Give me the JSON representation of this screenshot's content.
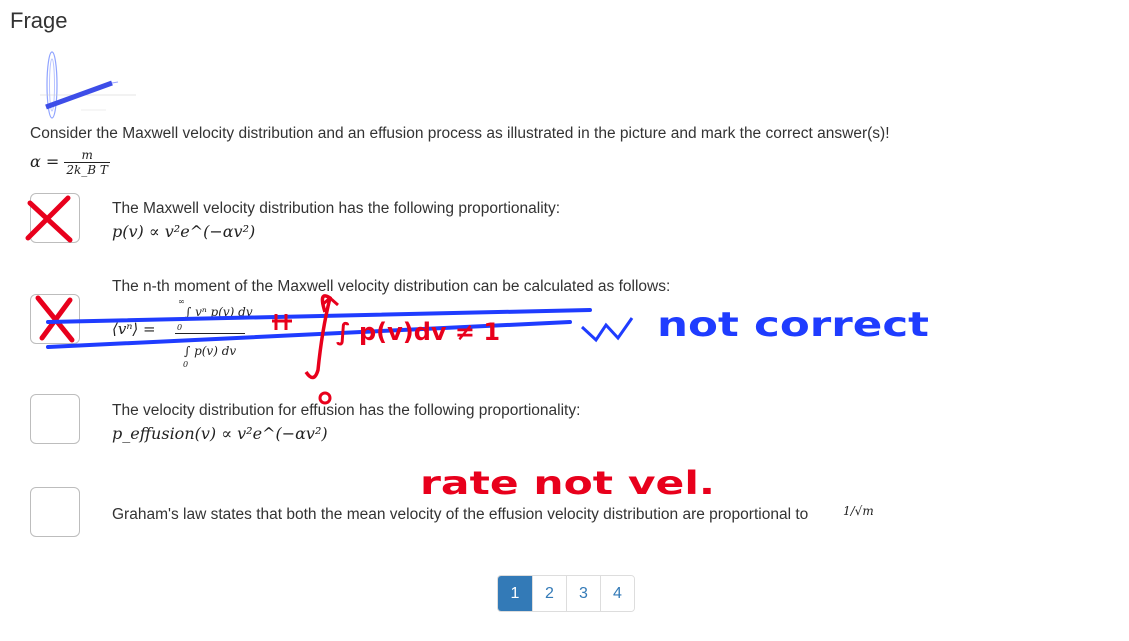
{
  "header": {
    "title": "Frage"
  },
  "question": {
    "text": "Consider the Maxwell velocity distribution and an effusion process as illustrated in the picture and mark the correct answer(s)!",
    "alpha_lhs": "α =",
    "alpha_num": "m",
    "alpha_den": "2k_B T"
  },
  "options": [
    {
      "text": "The Maxwell velocity distribution has the following proportionality:",
      "formula": "p(v) ∝ v²e^(−αv²)"
    },
    {
      "text": "The n-th moment of the Maxwell velocity distribution can be calculated as follows:",
      "formula_lhs": "⟨vⁿ⟩ =",
      "formula_num": "∫ vⁿ p(v) dv",
      "formula_den": "∫ p(v) dv",
      "upper_limit": "∞",
      "lower_limit": "0"
    },
    {
      "text": "The velocity distribution for effusion has the following proportionality:",
      "formula": "p_effusion(v) ∝ v²e^(−αv²)"
    },
    {
      "text": "Graham's law states that both the mean velocity of the effusion velocity distribution are proportional to",
      "formula": "1/√m"
    }
  ],
  "annotations": {
    "not_correct": "not correct",
    "integral_note": "∫ p(v)dv ≠ 1",
    "rate_note": "rate not vel."
  },
  "pagination": {
    "pages": [
      "1",
      "2",
      "3",
      "4"
    ],
    "active": "1"
  },
  "colors": {
    "accent": "#337ab7",
    "annotation_red": "#e8001c",
    "annotation_blue": "#1f3cff"
  }
}
